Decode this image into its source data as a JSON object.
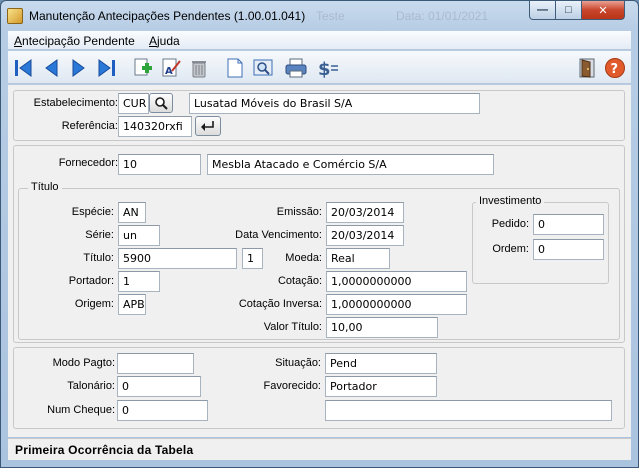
{
  "window": {
    "title": "Manutenção Antecipações Pendentes (1.00.01.041)",
    "ghost_title_1": "Teste",
    "ghost_title_2": "Data: 01/01/2021",
    "minimize_glyph": "—",
    "maximize_glyph": "□",
    "close_glyph": "✕"
  },
  "menu": {
    "items": [
      {
        "label": "Antecipação Pendente",
        "underline": "A"
      },
      {
        "label": "Ajuda",
        "underline": "A"
      }
    ]
  },
  "toolbar": {
    "buttons": [
      {
        "icon": "first-record-icon"
      },
      {
        "icon": "previous-record-icon"
      },
      {
        "icon": "next-record-icon"
      },
      {
        "icon": "last-record-icon"
      },
      {
        "icon": "add-record-icon"
      },
      {
        "icon": "edit-record-icon"
      },
      {
        "icon": "delete-trash-icon"
      },
      {
        "icon": "blank-document-icon"
      },
      {
        "icon": "search-document-icon"
      },
      {
        "icon": "print-icon"
      },
      {
        "icon": "currency-icon"
      },
      {
        "icon": "exit-door-icon"
      },
      {
        "icon": "help-icon"
      }
    ]
  },
  "header": {
    "estabelecimento_label": "Estabelecimento:",
    "estabelecimento_code": "CUR",
    "estabelecimento_name": "Lusatad Móveis do Brasil S/A",
    "referencia_label": "Referência:",
    "referencia_value": "140320rxfi"
  },
  "fornecedor": {
    "label": "Fornecedor:",
    "code": "10",
    "name": "Mesbla Atacado e Comércio S/A"
  },
  "titulo": {
    "legend": "Título",
    "especie_label": "Espécie:",
    "especie_value": "AN",
    "serie_label": "Série:",
    "serie_value": "un",
    "titulo_label": "Título:",
    "titulo_value": "5900",
    "parcela_value": "1",
    "portador_label": "Portador:",
    "portador_value": "1",
    "origem_label": "Origem:",
    "origem_value": "APB",
    "emissao_label": "Emissão:",
    "emissao_value": "20/03/2014",
    "vencimento_label": "Data Vencimento:",
    "vencimento_value": "20/03/2014",
    "moeda_label": "Moeda:",
    "moeda_value": "Real",
    "cotacao_label": "Cotação:",
    "cotacao_value": "1,0000000000",
    "cotacao_inversa_label": "Cotação Inversa:",
    "cotacao_inversa_value": "1,0000000000",
    "valor_label": "Valor Título:",
    "valor_value": "10,00"
  },
  "investimento": {
    "legend": "Investimento",
    "pedido_label": "Pedido:",
    "pedido_value": "0",
    "ordem_label": "Ordem:",
    "ordem_value": "0"
  },
  "pagamento": {
    "modo_label": "Modo Pagto:",
    "modo_value": "",
    "talonario_label": "Talonário:",
    "talonario_value": "0",
    "cheque_label": "Num Cheque:",
    "cheque_value": "0",
    "situacao_label": "Situação:",
    "situacao_value": "Pend",
    "favorecido_label": "Favorecido:",
    "favorecido_value": "Portador",
    "extra_value": ""
  },
  "status": {
    "text": "Primeira Ocorrência da Tabela"
  }
}
